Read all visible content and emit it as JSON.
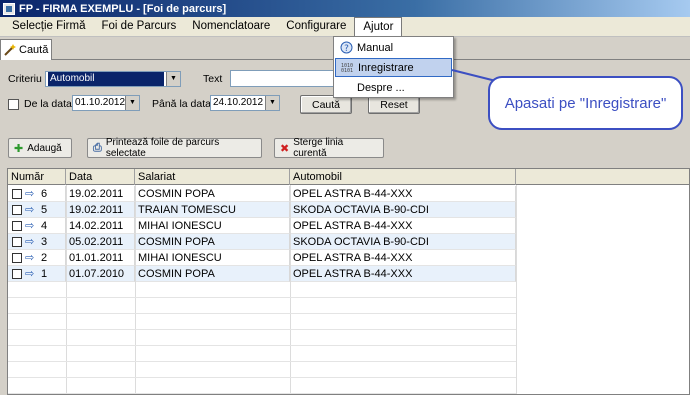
{
  "window": {
    "title": "FP - FIRMA EXEMPLU - [Foi de parcurs]"
  },
  "menubar": {
    "items": [
      "Selecție Firmă",
      "Foi de Parcurs",
      "Nomenclatoare",
      "Configurare",
      "Ajutor"
    ],
    "active_index": 4
  },
  "tab": {
    "label": "Caută"
  },
  "filters": {
    "criteriu_label": "Criteriu",
    "criteriu_value": "Automobil",
    "text_label": "Text",
    "text_value": "",
    "from_label": "De la data",
    "from_value": "01.10.2012",
    "to_label": "Până la data",
    "to_value": "24.10.2012",
    "search_button": "Caută",
    "reset_button": "Reset"
  },
  "toolbar": {
    "add_label": "Adaugă",
    "print_label": "Printează foile de parcurs selectate",
    "delete_label": "Sterge linia curentă"
  },
  "grid": {
    "columns": [
      "Număr",
      "Data",
      "Salariat",
      "Automobil"
    ],
    "rows": [
      {
        "numar": "6",
        "data": "19.02.2011",
        "salariat": "COSMIN POPA",
        "automobil": "OPEL ASTRA B-44-XXX"
      },
      {
        "numar": "5",
        "data": "19.02.2011",
        "salariat": "TRAIAN TOMESCU",
        "automobil": "SKODA OCTAVIA B-90-CDI"
      },
      {
        "numar": "4",
        "data": "14.02.2011",
        "salariat": "MIHAI IONESCU",
        "automobil": "OPEL ASTRA B-44-XXX"
      },
      {
        "numar": "3",
        "data": "05.02.2011",
        "salariat": "COSMIN POPA",
        "automobil": "SKODA OCTAVIA B-90-CDI"
      },
      {
        "numar": "2",
        "data": "01.01.2011",
        "salariat": "MIHAI IONESCU",
        "automobil": "OPEL ASTRA B-44-XXX"
      },
      {
        "numar": "1",
        "data": "01.07.2010",
        "salariat": "COSMIN POPA",
        "automobil": "OPEL ASTRA B-44-XXX"
      }
    ]
  },
  "help_menu": {
    "items": [
      {
        "label": "Manual",
        "icon": "help-icon"
      },
      {
        "label": "Inregistrare",
        "icon": "registration-icon"
      },
      {
        "label": "Despre ...",
        "icon": ""
      }
    ],
    "highlighted_index": 1
  },
  "callout": {
    "text": "Apasati pe \"Inregistrare\""
  },
  "colors": {
    "accent": "#0a246a",
    "callout": "#3c4fc2",
    "highlight": "#c1d2ee"
  }
}
